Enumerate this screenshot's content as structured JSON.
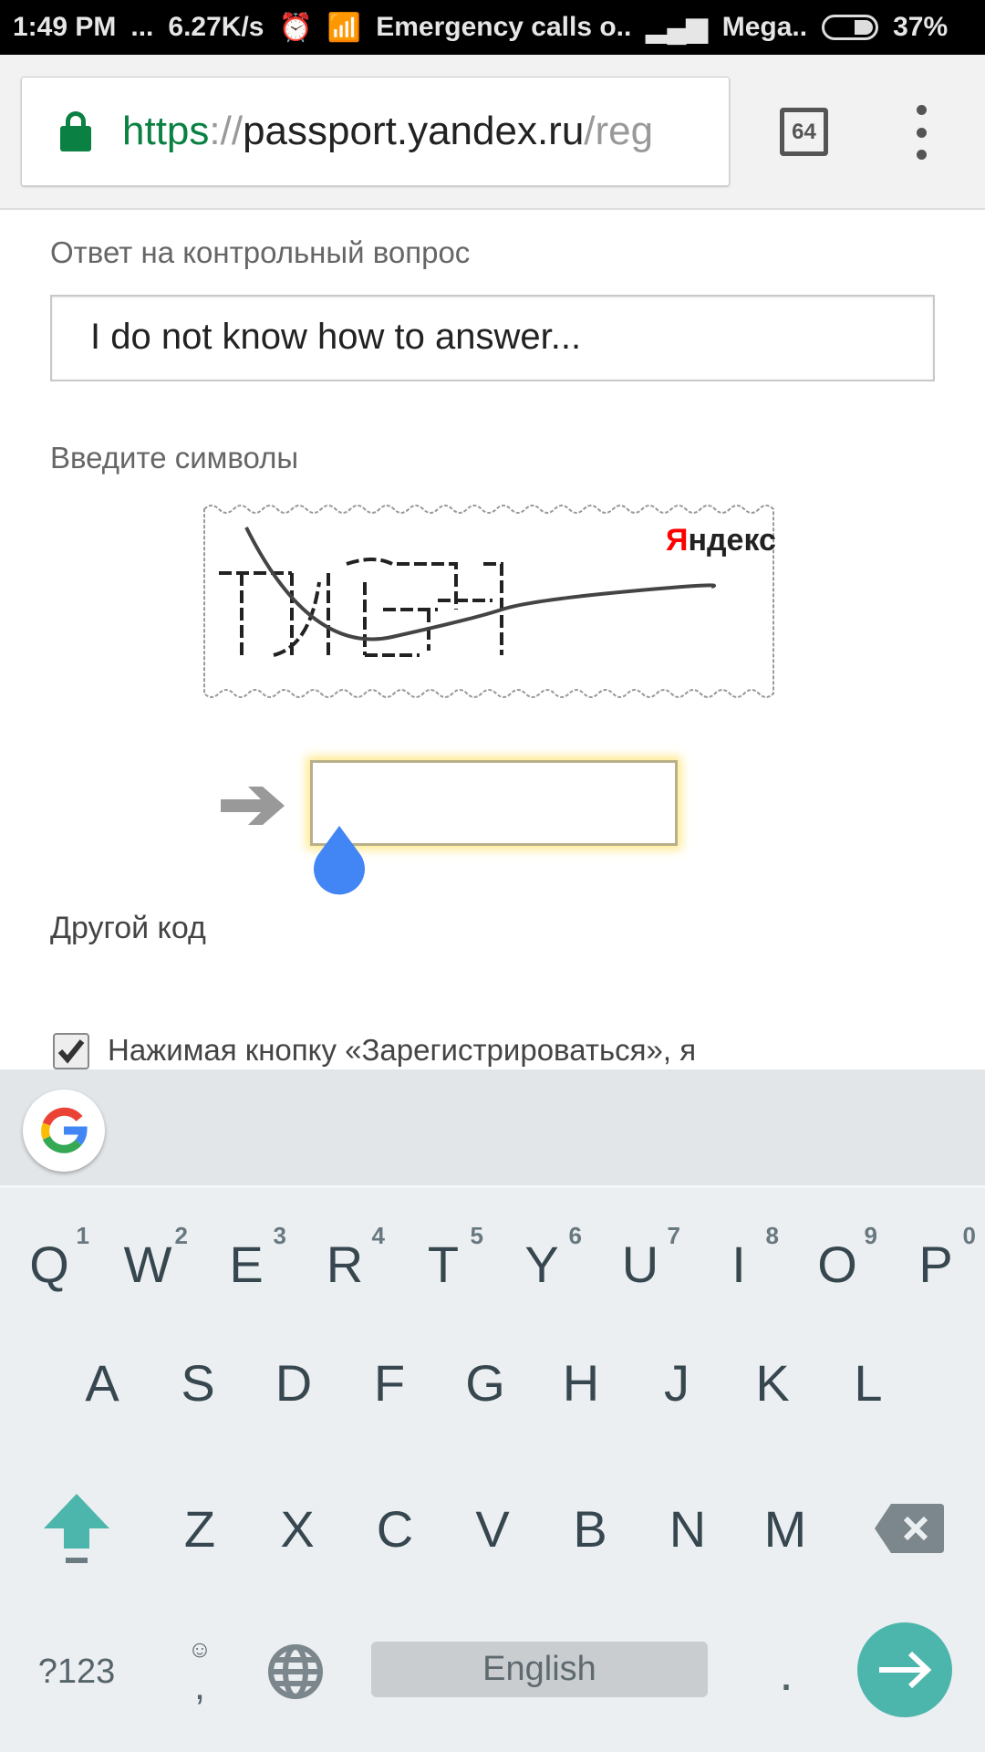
{
  "status_bar": {
    "time": "1:49 PM",
    "dots": "...",
    "speed": "6.27K/s",
    "carrier1": "Emergency calls o..",
    "carrier2": "Mega..",
    "battery": "37%",
    "battery_level": 0.37,
    "icons": [
      "alarm-icon",
      "wifi-icon",
      "signal-icon",
      "battery-icon"
    ]
  },
  "browser": {
    "url_scheme": "https",
    "url_sep": "://",
    "url_host": "passport.yandex.ru",
    "url_path": "/reg",
    "tab_count": "64"
  },
  "form": {
    "answer_label": "Ответ на контрольный вопрос",
    "answer_value": "I do not know how to answer...",
    "captcha_label": "Введите символы",
    "captcha_brand_first": "Я",
    "captcha_brand_rest": "ндекс",
    "captcha_code_value": "",
    "other_code_link": "Другой код",
    "agree_checked": true,
    "agree_text": "Нажимая кнопку «Зарегистрироваться», я"
  },
  "keyboard": {
    "row1": [
      {
        "k": "Q",
        "n": "1"
      },
      {
        "k": "W",
        "n": "2"
      },
      {
        "k": "E",
        "n": "3"
      },
      {
        "k": "R",
        "n": "4"
      },
      {
        "k": "T",
        "n": "5"
      },
      {
        "k": "Y",
        "n": "6"
      },
      {
        "k": "U",
        "n": "7"
      },
      {
        "k": "I",
        "n": "8"
      },
      {
        "k": "O",
        "n": "9"
      },
      {
        "k": "P",
        "n": "0"
      }
    ],
    "row2": [
      "A",
      "S",
      "D",
      "F",
      "G",
      "H",
      "J",
      "K",
      "L"
    ],
    "row3": [
      "Z",
      "X",
      "C",
      "V",
      "B",
      "N",
      "M"
    ],
    "symbols": "?123",
    "comma": ",",
    "period": ".",
    "space": "English",
    "accent": "#4db6ac"
  }
}
